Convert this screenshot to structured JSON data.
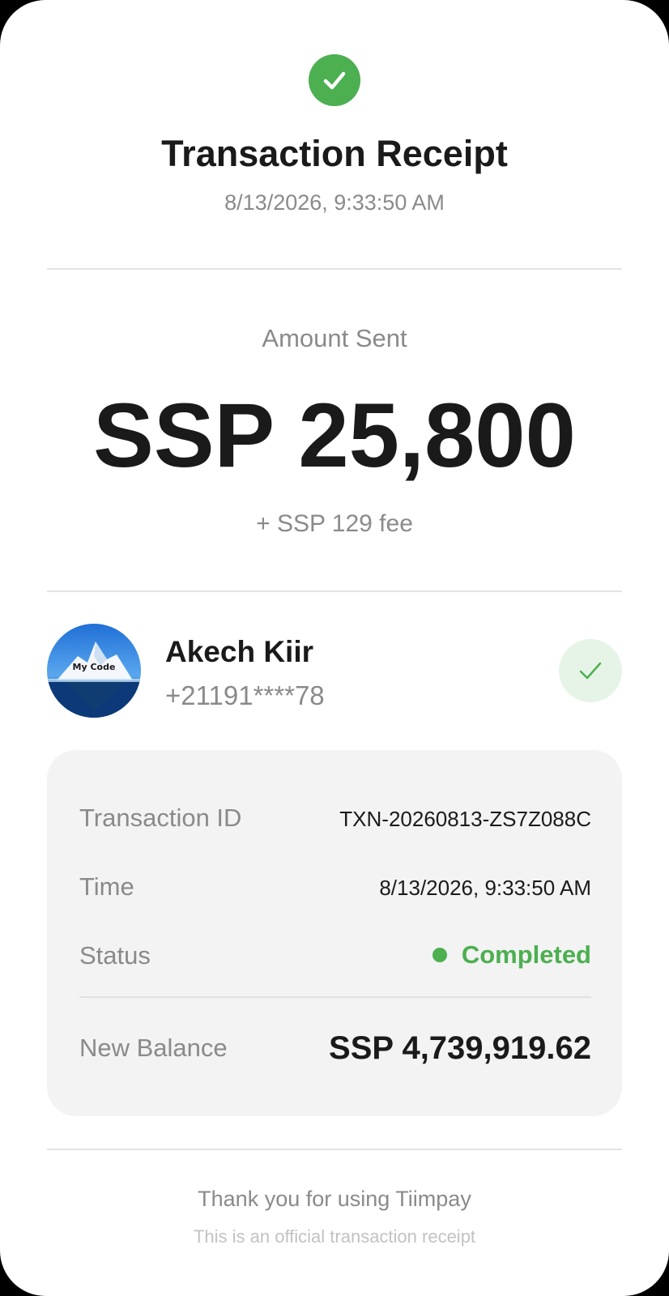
{
  "receipt": {
    "title": "Transaction Receipt",
    "datetime": "8/13/2026, 9:33:50 AM"
  },
  "amount": {
    "label": "Amount Sent",
    "value": "SSP 25,800",
    "fee": "+ SSP 129 fee"
  },
  "recipient": {
    "name": "Akech Kiir",
    "phone": "+21191****78",
    "avatar_text": "My Code"
  },
  "details": {
    "rows": [
      {
        "label": "Transaction ID",
        "value": "TXN-20260813-ZS7Z088C"
      },
      {
        "label": "Time",
        "value": "8/13/2026, 9:33:50 AM"
      },
      {
        "label": "Status",
        "value": "Completed"
      },
      {
        "label": "New Balance",
        "value": "SSP 4,739,919.62"
      }
    ]
  },
  "footer": {
    "thanks": "Thank you for using Tiimpay",
    "note": "This is an official transaction receipt"
  },
  "colors": {
    "success": "#4caf50",
    "success_light": "#e6f4e7",
    "text_primary": "#1a1a1a",
    "text_secondary": "#8a8a8a",
    "panel_bg": "#f3f3f3"
  },
  "icons": {
    "header": "check-circle-icon",
    "verified": "check-icon",
    "status": "status-dot-icon"
  }
}
